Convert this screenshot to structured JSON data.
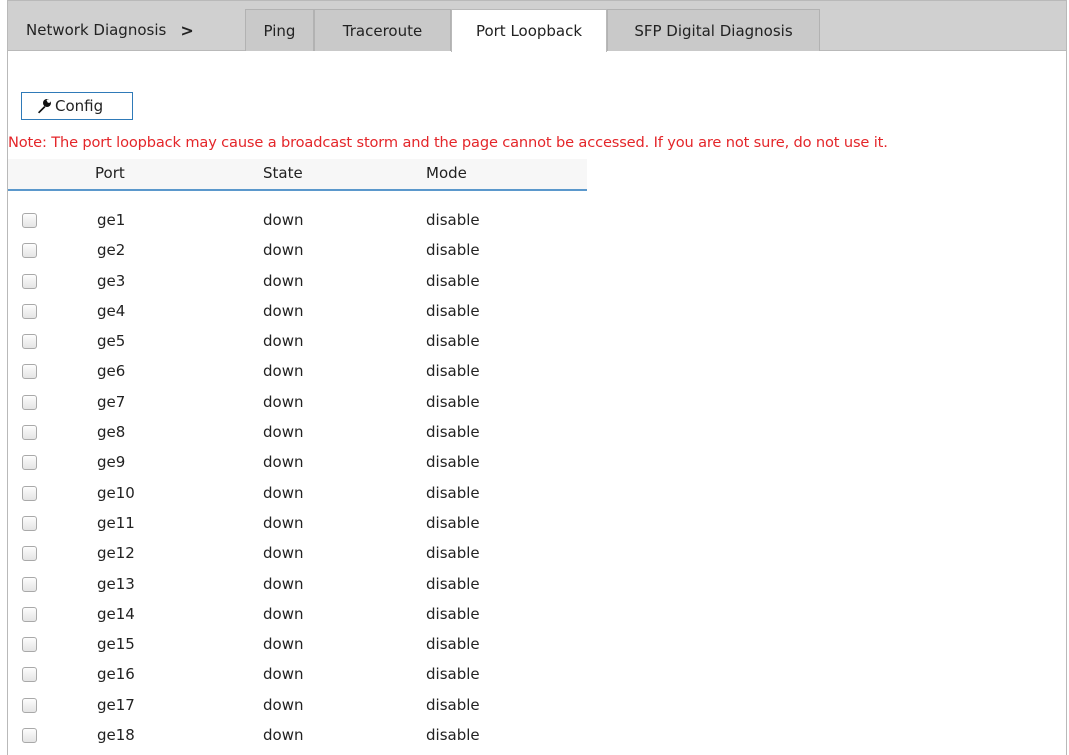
{
  "breadcrumb": {
    "label": "Network Diagnosis",
    "separator": ">"
  },
  "tabs": [
    {
      "label": "Ping",
      "active": false
    },
    {
      "label": "Traceroute",
      "active": false
    },
    {
      "label": "Port Loopback",
      "active": true
    },
    {
      "label": "SFP Digital Diagnosis",
      "active": false
    }
  ],
  "toolbar": {
    "config_label": "Config",
    "config_icon": "wrench-icon"
  },
  "note": "Note: The port loopback may cause a broadcast storm and the page cannot be accessed. If you are not sure, do not use it.",
  "colors": {
    "note": "#e4262a",
    "header_underline": "#5b98cc",
    "button_border": "#2f7ab8"
  },
  "table": {
    "columns": [
      "Port",
      "State",
      "Mode"
    ],
    "rows": [
      {
        "port": "ge1",
        "state": "down",
        "mode": "disable"
      },
      {
        "port": "ge2",
        "state": "down",
        "mode": "disable"
      },
      {
        "port": "ge3",
        "state": "down",
        "mode": "disable"
      },
      {
        "port": "ge4",
        "state": "down",
        "mode": "disable"
      },
      {
        "port": "ge5",
        "state": "down",
        "mode": "disable"
      },
      {
        "port": "ge6",
        "state": "down",
        "mode": "disable"
      },
      {
        "port": "ge7",
        "state": "down",
        "mode": "disable"
      },
      {
        "port": "ge8",
        "state": "down",
        "mode": "disable"
      },
      {
        "port": "ge9",
        "state": "down",
        "mode": "disable"
      },
      {
        "port": "ge10",
        "state": "down",
        "mode": "disable"
      },
      {
        "port": "ge11",
        "state": "down",
        "mode": "disable"
      },
      {
        "port": "ge12",
        "state": "down",
        "mode": "disable"
      },
      {
        "port": "ge13",
        "state": "down",
        "mode": "disable"
      },
      {
        "port": "ge14",
        "state": "down",
        "mode": "disable"
      },
      {
        "port": "ge15",
        "state": "down",
        "mode": "disable"
      },
      {
        "port": "ge16",
        "state": "down",
        "mode": "disable"
      },
      {
        "port": "ge17",
        "state": "down",
        "mode": "disable"
      },
      {
        "port": "ge18",
        "state": "down",
        "mode": "disable"
      }
    ]
  }
}
